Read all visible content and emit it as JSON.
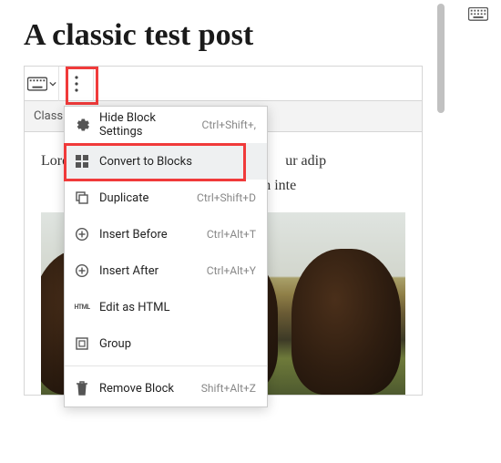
{
  "page": {
    "title": "A classic test post"
  },
  "toolbar": {
    "keyboard_icon": "keyboard-icon",
    "more_icon": "more-vertical-icon"
  },
  "tabs": {
    "classic_label": "Class"
  },
  "content": {
    "para1_left": "Lore",
    "para1_right_a": "ur adip",
    "para1_right_b": "r urna, in inte"
  },
  "menu": {
    "items": [
      {
        "icon": "gear-icon",
        "label": "Hide Block Settings",
        "shortcut": "Ctrl+Shift+,",
        "highlight": false
      },
      {
        "icon": "grid-icon",
        "label": "Convert to Blocks",
        "shortcut": "",
        "highlight": true
      },
      {
        "icon": "duplicate-icon",
        "label": "Duplicate",
        "shortcut": "Ctrl+Shift+D",
        "highlight": false
      },
      {
        "icon": "insert-before-icon",
        "label": "Insert Before",
        "shortcut": "Ctrl+Alt+T",
        "highlight": false
      },
      {
        "icon": "insert-after-icon",
        "label": "Insert After",
        "shortcut": "Ctrl+Alt+Y",
        "highlight": false
      },
      {
        "icon": "html-icon",
        "label": "Edit as HTML",
        "shortcut": "",
        "highlight": false
      },
      {
        "icon": "group-icon",
        "label": "Group",
        "shortcut": "",
        "highlight": false
      }
    ],
    "remove": {
      "icon": "trash-icon",
      "label": "Remove Block",
      "shortcut": "Shift+Alt+Z"
    }
  }
}
